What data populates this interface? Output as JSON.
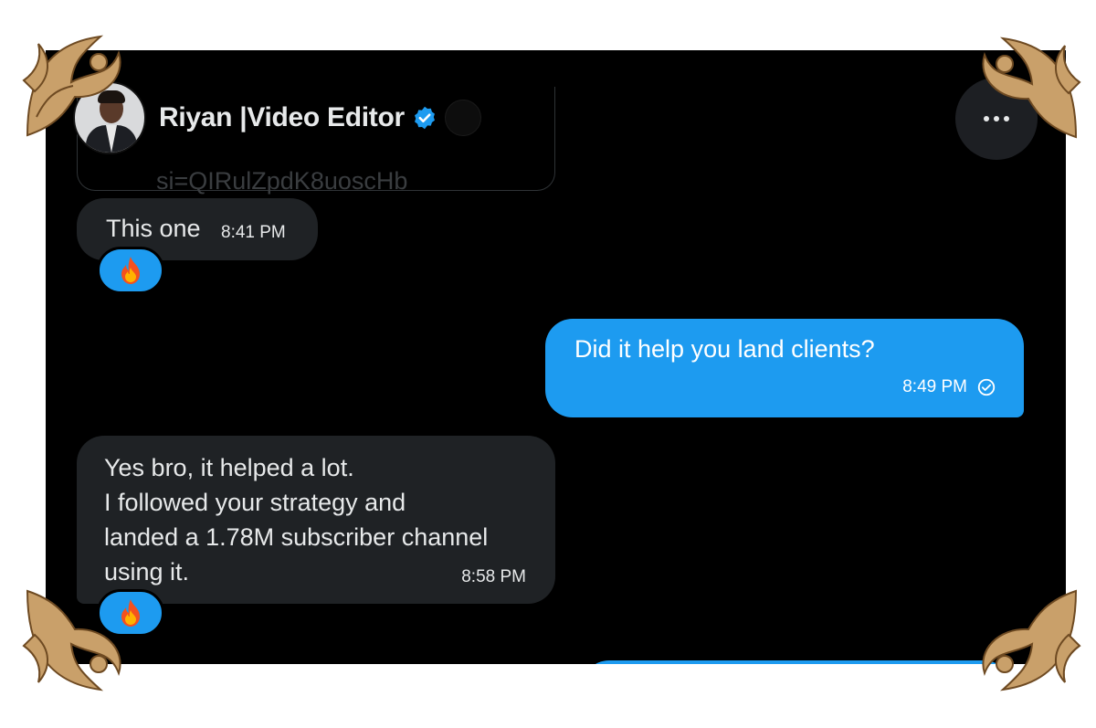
{
  "header": {
    "name": "Riyan |Video Editor",
    "verified_icon": "verified-badge-icon",
    "more_icon": "more-horizontal-icon"
  },
  "previous_card": {
    "text": "si=QIRulZpdK8uoscHb"
  },
  "messages": [
    {
      "direction": "incoming",
      "text": "This one",
      "time": "8:41 PM",
      "reaction": "🔥"
    },
    {
      "direction": "outgoing",
      "text": "Did it help you land clients?",
      "time": "8:49 PM",
      "status_icon": "sent-check-icon"
    },
    {
      "direction": "incoming",
      "lines": [
        "Yes bro, it helped a lot.",
        "I followed your strategy and",
        "landed a 1.78M subscriber channel",
        "using it."
      ],
      "time": "8:58 PM",
      "reaction": "🔥"
    }
  ],
  "colors": {
    "background": "#000000",
    "incoming_bubble": "#1f2225",
    "outgoing_bubble": "#1d9bf0",
    "text": "#e7e9ea",
    "ornament": "#c9a06a"
  }
}
